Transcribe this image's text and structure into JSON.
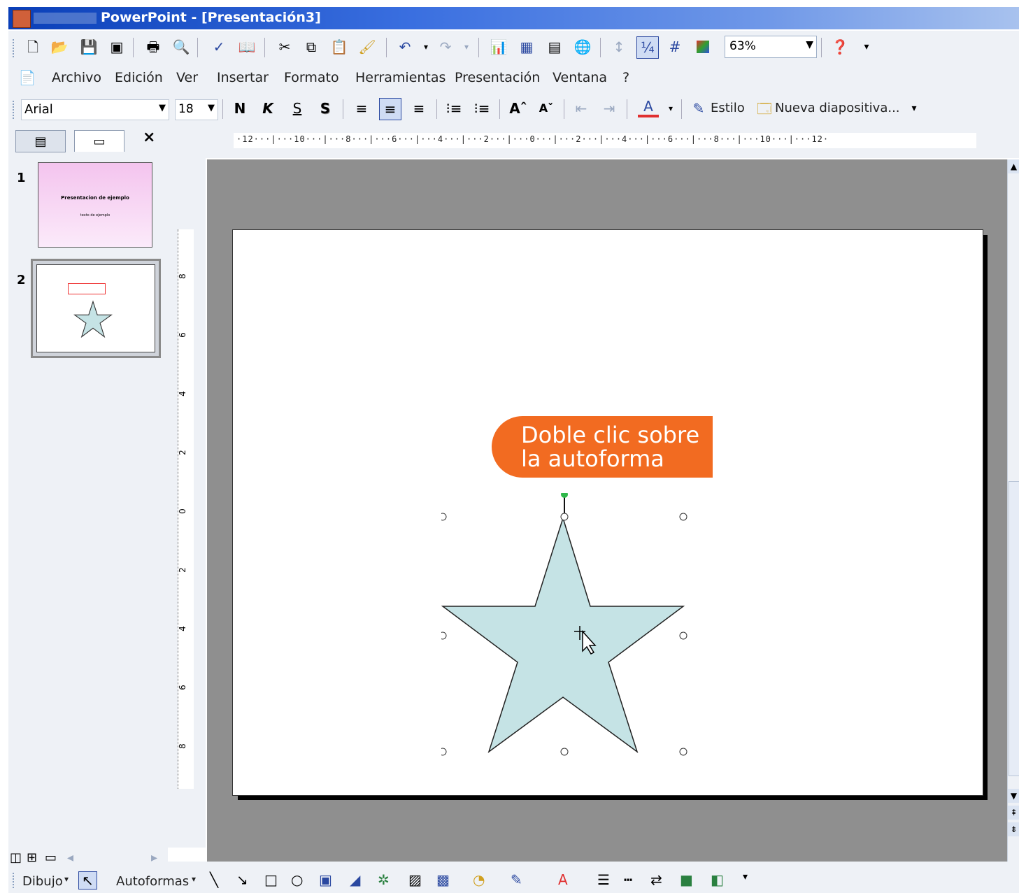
{
  "window": {
    "title": "PowerPoint - [Presentación3]"
  },
  "standard_toolbar": {
    "zoom": "63%",
    "icons": [
      "new-icon",
      "open-icon",
      "save-icon",
      "permission-icon",
      "print-icon",
      "print-preview-icon",
      "spelling-icon",
      "research-icon",
      "cut-icon",
      "copy-icon",
      "paste-icon",
      "format-painter-icon",
      "undo-icon",
      "redo-icon",
      "insert-chart-icon",
      "insert-table-icon",
      "tables-borders-icon",
      "insert-hyperlink-icon",
      "expand-icon",
      "show-formatting-icon",
      "grid-icon",
      "color-grayscale-icon",
      "help-icon"
    ]
  },
  "menu": {
    "items": [
      "Archivo",
      "Edición",
      "Ver",
      "Insertar",
      "Formato",
      "Herramientas",
      "Presentación",
      "Ventana",
      "?"
    ]
  },
  "format_toolbar": {
    "font": "Arial",
    "size": "18",
    "bold": "N",
    "italic": "K",
    "underline": "S",
    "shadow": "S",
    "font_color_glyph": "A",
    "style_label": "Estilo",
    "new_slide_label": "Nueva diapositiva..."
  },
  "slides_pane": {
    "close": "×",
    "slides": [
      {
        "number": "1",
        "title": "Presentacion de ejemplo",
        "subtitle": "texto de ejemplo"
      },
      {
        "number": "2",
        "title": ""
      }
    ]
  },
  "ruler": {
    "horizontal": "·12···|···10···|···8···|···6···|···4···|···2···|···0···|···2···|···4···|···6···|···8···|···10···|···12·",
    "vertical": [
      "8",
      "6",
      "4",
      "2",
      "0",
      "2",
      "4",
      "6",
      "8"
    ]
  },
  "slide": {
    "callout": "Doble clic sobre\nla autoforma",
    "shape_fill": "#c5e3e5"
  },
  "drawing_toolbar": {
    "draw_label": "Dibujo",
    "autoshapes_label": "Autoformas"
  },
  "colors": {
    "accent_callout": "#f26b21",
    "titlebar": "#0a3fb8"
  }
}
